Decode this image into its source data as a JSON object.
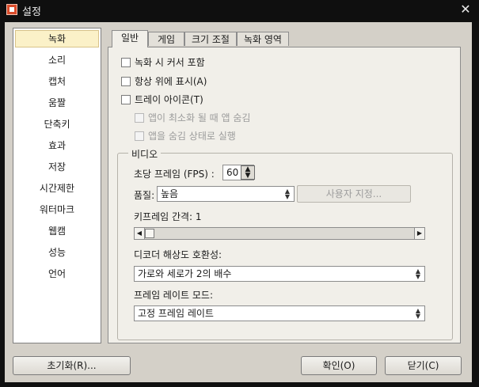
{
  "window": {
    "title": "설정"
  },
  "sidebar": {
    "items": [
      {
        "label": "녹화"
      },
      {
        "label": "소리"
      },
      {
        "label": "캡처"
      },
      {
        "label": "움짤"
      },
      {
        "label": "단축키"
      },
      {
        "label": "효과"
      },
      {
        "label": "저장"
      },
      {
        "label": "시간제한"
      },
      {
        "label": "워터마크"
      },
      {
        "label": "웹캠"
      },
      {
        "label": "성능"
      },
      {
        "label": "언어"
      }
    ],
    "selected": "녹화"
  },
  "tabs": [
    {
      "label": "일반"
    },
    {
      "label": "게임"
    },
    {
      "label": "크기 조절"
    },
    {
      "label": "녹화 영역"
    }
  ],
  "general": {
    "include_cursor": "녹화 시 커서 포함",
    "always_on_top": "항상 위에 표시(A)",
    "tray_icon": "트레이 아이콘(T)",
    "hide_when_minimized": "앱이 최소화 될 때 앱 숨김",
    "start_hidden": "앱을 숨김 상태로 실행"
  },
  "video": {
    "group_title": "비디오",
    "fps_label": "초당 프레임 (FPS) :",
    "fps_value": "60",
    "quality_label": "품질:",
    "quality_value": "높음",
    "custom_button": "사용자 지정...",
    "keyframe_label": "키프레임 간격: 1",
    "keyframe_value": 1,
    "decoder_label": "디코더 해상도 호환성:",
    "decoder_value": "가로와 세로가 2의 배수",
    "framerate_mode_label": "프레임 레이트 모드:",
    "framerate_mode_value": "고정 프레임 레이트"
  },
  "footer": {
    "reset_button": "초기화(R)...",
    "ok_button": "확인(O)",
    "close_button": "닫기(C)"
  }
}
